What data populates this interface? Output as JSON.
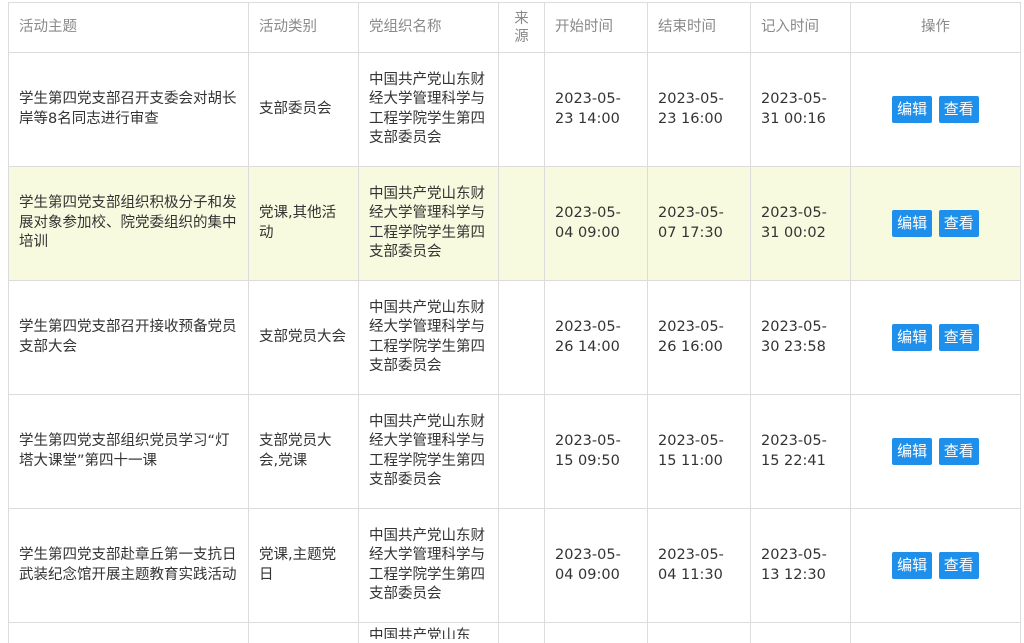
{
  "columns": [
    "活动主题",
    "活动类别",
    "党组织名称",
    "来\n源",
    "开始时间",
    "结束时间",
    "记入时间",
    "操作"
  ],
  "buttons": {
    "edit": "编辑",
    "view": "查看"
  },
  "rows": [
    {
      "topic": "学生第四党支部召开支委会对胡长岸等8名同志进行审查",
      "category": "支部委员会",
      "org": "中国共产党山东财经大学管理科学与工程学院学生第四支部委员会",
      "source": "",
      "start": "2023-05-23 14:00",
      "end": "2023-05-23 16:00",
      "recorded": "2023-05-31 00:16",
      "highlighted": false
    },
    {
      "topic": "学生第四党支部组织积极分子和发展对象参加校、院党委组织的集中培训",
      "category": "党课,其他活动",
      "org": "中国共产党山东财经大学管理科学与工程学院学生第四支部委员会",
      "source": "",
      "start": "2023-05-04 09:00",
      "end": "2023-05-07 17:30",
      "recorded": "2023-05-31 00:02",
      "highlighted": true
    },
    {
      "topic": "学生第四党支部召开接收预备党员支部大会",
      "category": "支部党员大会",
      "org": "中国共产党山东财经大学管理科学与工程学院学生第四支部委员会",
      "source": "",
      "start": "2023-05-26 14:00",
      "end": "2023-05-26 16:00",
      "recorded": "2023-05-30 23:58",
      "highlighted": false
    },
    {
      "topic": "学生第四党支部组织党员学习“灯塔大课堂”第四十一课",
      "category": "支部党员大会,党课",
      "org": "中国共产党山东财经大学管理科学与工程学院学生第四支部委员会",
      "source": "",
      "start": "2023-05-15 09:50",
      "end": "2023-05-15 11:00",
      "recorded": "2023-05-15 22:41",
      "highlighted": false
    },
    {
      "topic": "学生第四党支部赴章丘第一支抗日武装纪念馆开展主题教育实践活动",
      "category": "党课,主题党日",
      "org": "中国共产党山东财经大学管理科学与工程学院学生第四支部委员会",
      "source": "",
      "start": "2023-05-04 09:00",
      "end": "2023-05-04 11:30",
      "recorded": "2023-05-13 12:30",
      "highlighted": false
    }
  ],
  "partial_row": {
    "org": "中国共产党山东"
  }
}
